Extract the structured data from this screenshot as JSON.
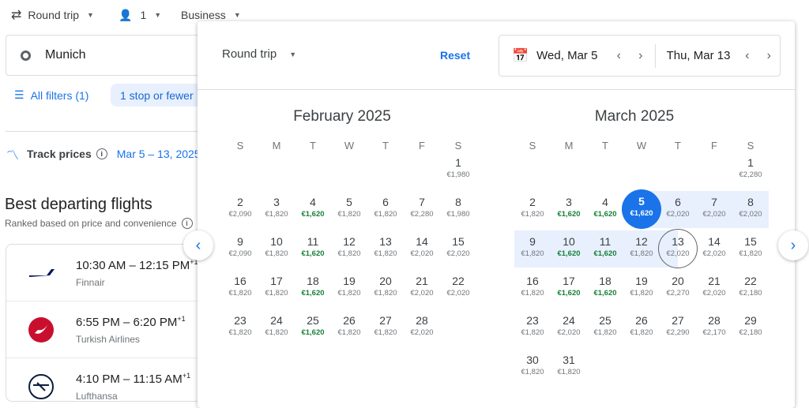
{
  "topbar": {
    "trip_type": "Round trip",
    "passengers": "1",
    "cabin": "Business"
  },
  "search": {
    "origin": "Munich"
  },
  "filters": {
    "all_filters": "All filters (1)",
    "stops_chip": "1 stop or fewer"
  },
  "track": {
    "label": "Track prices",
    "dates": "Mar 5 – 13, 2025"
  },
  "results": {
    "title": "Best departing flights",
    "subtitle": "Ranked based on price and convenience",
    "flights": [
      {
        "times": "10:30 AM – 12:15 PM",
        "offset": "+1",
        "airline": "Finnair",
        "logo": "finnair-logo"
      },
      {
        "times": "6:55 PM – 6:20 PM",
        "offset": "+1",
        "airline": "Turkish Airlines",
        "logo": "turkish-airlines-logo"
      },
      {
        "times": "4:10 PM – 11:15 AM",
        "offset": "+1",
        "airline": "Lufthansa",
        "logo": "lufthansa-logo"
      }
    ]
  },
  "picker": {
    "trip_type": "Round trip",
    "reset": "Reset",
    "depart": "Wed, Mar 5",
    "return": "Thu, Mar 13",
    "weekdays": [
      "S",
      "M",
      "T",
      "W",
      "T",
      "F",
      "S"
    ],
    "cheap_price": "€1,620",
    "colors": {
      "accent": "#1a73e8",
      "range": "#e8f0fe",
      "cheap": "#188038"
    },
    "months": [
      {
        "title": "February 2025",
        "first_weekday": 6,
        "prices": [
          "€1,980",
          "€2,090",
          "€1,820",
          "€1,620",
          "€1,820",
          "€1,820",
          "€2,280",
          "€1,980",
          "€2,090",
          "€1,820",
          "€1,620",
          "€1,820",
          "€1,820",
          "€2,020",
          "€2,020",
          "€1,820",
          "€1,820",
          "€1,620",
          "€1,820",
          "€1,820",
          "€2,020",
          "€2,020",
          "€1,820",
          "€1,820",
          "€1,620",
          "€1,820",
          "€1,820",
          "€2,020"
        ]
      },
      {
        "title": "March 2025",
        "first_weekday": 6,
        "selected_depart": 5,
        "selected_return": 13,
        "prices": [
          "€2,280",
          "€1,820",
          "€1,620",
          "€1,620",
          "€1,620",
          "€2,020",
          "€2,020",
          "€2,020",
          "€1,820",
          "€1,620",
          "€1,620",
          "€1,820",
          "€2,020",
          "€2,020",
          "€1,820",
          "€1,820",
          "€1,620",
          "€1,620",
          "€1,820",
          "€2,270",
          "€2,020",
          "€2,180",
          "€1,820",
          "€2,020",
          "€1,820",
          "€1,820",
          "€2,290",
          "€2,170",
          "€2,180",
          "€1,820",
          "€1,820"
        ]
      }
    ]
  }
}
